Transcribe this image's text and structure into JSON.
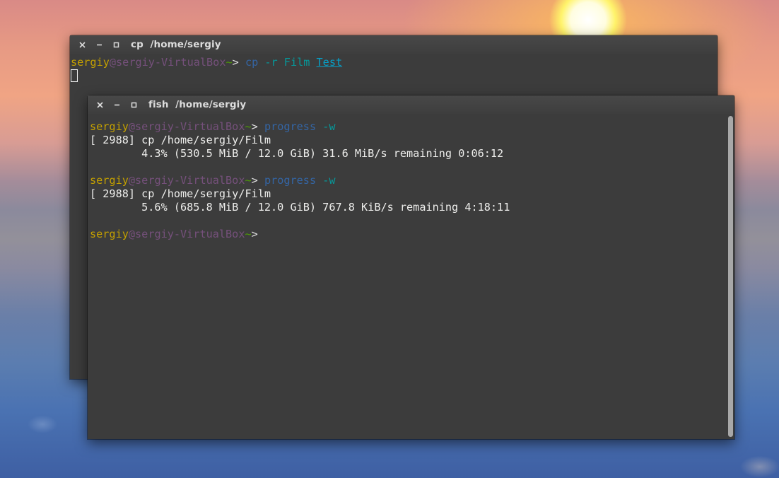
{
  "back_window": {
    "title_cmd": "cp",
    "title_path": "/home/sergiy",
    "prompt": {
      "user": "sergiy",
      "at": "@",
      "host": "sergiy-VirtualBox",
      "tilde": "~",
      "gt": "> "
    },
    "command": {
      "name": "cp",
      "args": " -r Film ",
      "arg_underlined": "Test"
    }
  },
  "front_window": {
    "title_cmd": "fish",
    "title_path": "/home/sergiy",
    "prompt": {
      "user": "sergiy",
      "at": "@",
      "host": "sergiy-VirtualBox",
      "tilde": "~",
      "gt": "> "
    },
    "blocks": [
      {
        "command": "progress",
        "arg": " -w",
        "proc_line": "[ 2988] cp /home/sergiy/Film",
        "stat_line": "        4.3% (530.5 MiB / 12.0 GiB) 31.6 MiB/s remaining 0:06:12"
      },
      {
        "command": "progress",
        "arg": " -w",
        "proc_line": "[ 2988] cp /home/sergiy/Film",
        "stat_line": "        5.6% (685.8 MiB / 12.0 GiB) 767.8 KiB/s remaining 4:18:11"
      }
    ]
  },
  "window_buttons": {
    "close_icon": "close-icon",
    "minimize_icon": "minimize-icon",
    "maximize_icon": "maximize-icon"
  },
  "colors": {
    "terminal_bg": "#3c3c3c",
    "prompt_user": "#c4a000",
    "prompt_host": "#75507b",
    "prompt_tilde": "#4e9a06",
    "command": "#3465a4",
    "argument": "#06989a"
  }
}
